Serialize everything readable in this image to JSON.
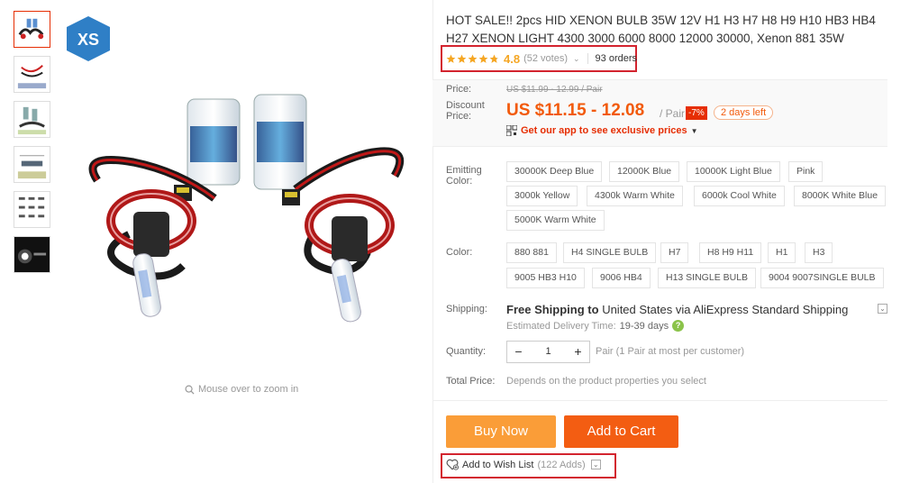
{
  "product": {
    "title": "HOT SALE!! 2pcs HID XENON BULB 35W 12V H1 H3 H7 H8 H9 H10 HB3 HB4 H27 XENON LIGHT 4300 3000 6000 8000 12000 30000, Xenon 881 35W",
    "brand_logo_text": "XS",
    "rating": "4.8",
    "rating_stars": 4.8,
    "votes": "(52 votes)",
    "orders": "93 orders",
    "zoom_hint": "Mouse over to zoom in"
  },
  "price": {
    "label": "Price:",
    "original": "US $11.99 - 12.99 / Pair",
    "discount_label": "Discount Price:",
    "current": "US $11.15 - 12.08",
    "unit": "/ Pair",
    "discount": "-7%",
    "days_left": "2 days left",
    "app_promo": "Get our app to see exclusive prices"
  },
  "emitting_color": {
    "label": "Emitting Color:",
    "options": [
      "30000K Deep Blue",
      "12000K Blue",
      "10000K Light Blue",
      "Pink",
      "3000k Yellow",
      "4300k Warm White",
      "6000k Cool White",
      "8000K White Blue",
      "5000K Warm White"
    ]
  },
  "color": {
    "label": "Color:",
    "options": [
      "880 881",
      "H4 SINGLE BULB",
      "H7",
      "H8 H9 H11",
      "H1",
      "H3",
      "9005 HB3 H10",
      "9006 HB4",
      "H13 SINGLE BULB",
      "9004 9007SINGLE BULB"
    ]
  },
  "shipping": {
    "label": "Shipping:",
    "free": "Free Shipping to",
    "destination": "United States via AliExpress Standard Shipping",
    "delivery_label": "Estimated Delivery Time:",
    "delivery_days": "19-39 days"
  },
  "quantity": {
    "label": "Quantity:",
    "value": "1",
    "minus": "−",
    "plus": "+",
    "note": "Pair (1 Pair at most per customer)"
  },
  "total": {
    "label": "Total Price:",
    "note": "Depends on the product properties you select"
  },
  "actions": {
    "buy_now": "Buy Now",
    "add_to_cart": "Add to Cart",
    "wish_list": "Add to Wish List",
    "wish_count": "(122 Adds)"
  },
  "colors": {
    "accent": "#e62e04",
    "price": "#f25a0b",
    "buy_now": "#fa9d38",
    "add_cart": "#f35d12",
    "highlight_box": "#d3242f",
    "star": "#f5a623"
  }
}
